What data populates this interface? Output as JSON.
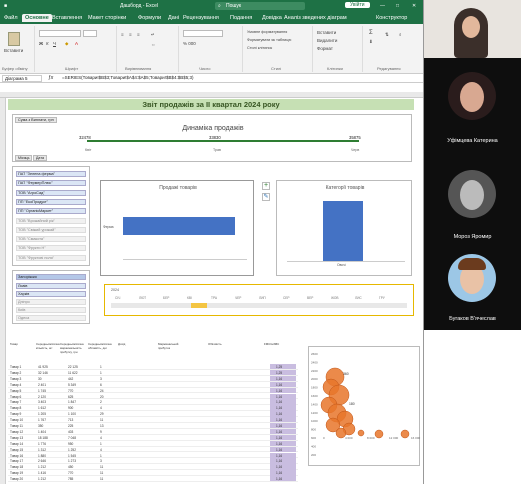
{
  "window": {
    "title": "Дашборд - Excel",
    "file_tab": "Файл",
    "search": "Пошук",
    "user_badge": "Увійти"
  },
  "ribbon": {
    "tabs": [
      "Основне",
      "Вставлення",
      "Макет сторінки",
      "Формули",
      "Дані",
      "Рецензування",
      "Подання",
      "Довідка",
      "Аналіз зведених діаграм",
      "Конструктор"
    ],
    "paste": "Вставити",
    "clipboard": "Буфер обміну",
    "font": "Шрифт",
    "alignment": "Вирівнювання",
    "number": "Число",
    "cond_format": "Умовне форматування",
    "format_table": "Форматувати як таблицю",
    "cell_styles": "Стилі клітинок",
    "styles": "Стилі",
    "insert": "Вставити",
    "delete": "Видалити",
    "format": "Формат",
    "cells": "Клітинки",
    "editing": "Редагування"
  },
  "formula_bar": {
    "name_box": "Діаграма 5",
    "formula": "=SERIES(Товари!$B$3;Товари!$A$4:$A$5;Товари!$B$4:$B$5;3)"
  },
  "dashboard": {
    "title": "Звіт продажів за ІІ квартал 2024 року",
    "filter_chip": "Сума з Виплати, грн",
    "dynamics": {
      "title": "Динаміка продажів",
      "values": [
        "32478",
        "33830",
        "35875"
      ],
      "months": [
        "Квіт",
        "Трав",
        "Черв"
      ],
      "labels": [
        "Місяць",
        "Дата"
      ]
    },
    "product_chart": {
      "title": "Продажі товарів",
      "category": "Ферма"
    },
    "category_chart": {
      "title": "Категорії товарів",
      "category": "Овочі"
    },
    "timeline": {
      "year": "2024",
      "months": [
        "СІЧ",
        "ЛЮТ",
        "БЕР",
        "КВІ",
        "ТРА",
        "ЧЕР",
        "ЛИП",
        "СЕР",
        "ВЕР",
        "ЖОВ",
        "ЛИС",
        "ГРУ"
      ]
    }
  },
  "slicer_suppliers": [
    "ПАТ \"Зелена ферма\"",
    "ПАТ \"ФермерПлюс\"",
    "ТОВ \"АгроСад\"",
    "ПП \"ЕкоПродукт\"",
    "ПП \"ОрганікМаркет\"",
    "ТОВ \"Врожайний рік\"",
    "ТОВ \"Свіжий урожай\"",
    "ТОВ \"Смакота\"",
    "ТОВ \"Фрукти Н\"",
    "ТОВ \"Фруктові поля\""
  ],
  "slicer_cities": {
    "header": "Запоріжжя",
    "items": [
      "Львів",
      "Харків",
      "Дніпро",
      "Київ",
      "Одеса"
    ]
  },
  "table": {
    "headers": [
      "Товар",
      "Середньомісячна кількість, шт",
      "Середньомісячна маржинальність прибутку, грн",
      "Середньомісячна обіговість, дні",
      "Дохід",
      "Маржинальний прибуток",
      "Обіговість",
      "FMCG/ABC"
    ],
    "rows": [
      [
        "Товар 1",
        "41 925",
        "22 125",
        "1",
        "1,25"
      ],
      [
        "Товар 2",
        "32 146",
        "11 622",
        "1",
        "1,25"
      ],
      [
        "Товар 3",
        "30",
        "442",
        "3",
        "1,16"
      ],
      [
        "Товар 4",
        "2 401",
        "5 349",
        "6",
        "1,16"
      ],
      [
        "Товар 5",
        "1 745",
        "770",
        "24",
        "1,16"
      ],
      [
        "Товар 6",
        "2 120",
        "625",
        "20",
        "1,16"
      ],
      [
        "Товар 7",
        "3 403",
        "1 847",
        "2",
        "1,16"
      ],
      [
        "Товар 8",
        "1 612",
        "900",
        "4",
        "1,16"
      ],
      [
        "Товар 9",
        "1 205",
        "1 100",
        "29",
        "1,16"
      ],
      [
        "Товар 10",
        "1 767",
        "713",
        "11",
        "1,16"
      ],
      [
        "Товар 11",
        "350",
        "225",
        "13",
        "1,16"
      ],
      [
        "Товар 12",
        "1 404",
        "403",
        "9",
        "1,16"
      ],
      [
        "Товар 13",
        "18 188",
        "7 048",
        "4",
        "1,16"
      ],
      [
        "Товар 14",
        "1 776",
        "950",
        "1",
        "1,16"
      ],
      [
        "Товар 15",
        "1 312",
        "1 252",
        "4",
        "1,16"
      ],
      [
        "Товар 16",
        "1 880",
        "1 545",
        "1",
        "1,16"
      ],
      [
        "Товар 17",
        "2 646",
        "1 273",
        "3",
        "1,16"
      ],
      [
        "Товар 18",
        "1 212",
        "450",
        "11",
        "1,16"
      ],
      [
        "Товар 19",
        "1 416",
        "770",
        "11",
        "1,16"
      ],
      [
        "Товар 20",
        "1 212",
        "785",
        "11",
        "1,16"
      ]
    ]
  },
  "bubble": {
    "labels": [
      "2600",
      "2400",
      "2200",
      "2000",
      "1800",
      "1600",
      "1400",
      "1200",
      "1000",
      "800",
      "600",
      "400",
      "200"
    ],
    "x_labels": [
      "0",
      "4 000",
      "8 000",
      "12 000",
      "16 000"
    ],
    "tags": [
      "360",
      "180"
    ]
  },
  "participants": [
    {
      "name": "Уфімцева Катерина"
    },
    {
      "name": "Мороз Яромир"
    },
    {
      "name": "Бугаков В'ячеслав"
    }
  ],
  "colors": {
    "excel_green": "#1e7145",
    "bar_blue": "#4472c4",
    "title_band": "#c6e0b4"
  }
}
